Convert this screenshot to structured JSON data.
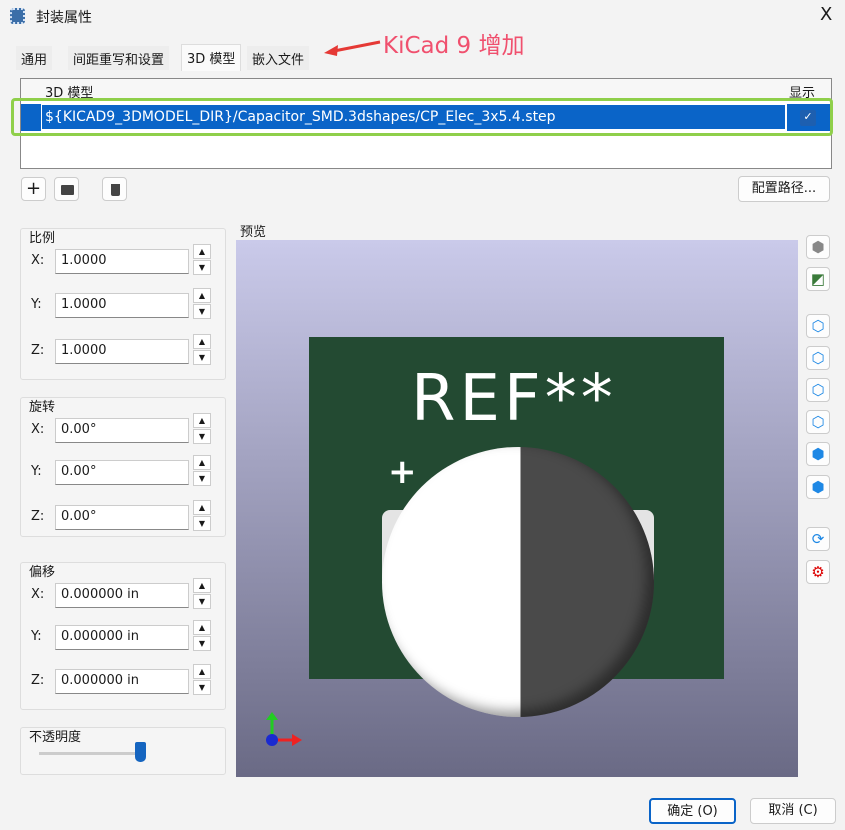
{
  "window": {
    "title": "封装属性",
    "close": "X"
  },
  "annotation": "KiCad 9 增加",
  "tabs": [
    "通用",
    "间距重写和设置",
    "3D 模型",
    "嵌入文件"
  ],
  "models_table": {
    "headers": [
      "3D 模型",
      "显示"
    ],
    "rows": [
      {
        "path": "${KICAD9_3DMODEL_DIR}/Capacitor_SMD.3dshapes/CP_Elec_3x5.4.step",
        "shown": true
      }
    ]
  },
  "toolbar": {
    "add": "+",
    "configure_paths": "配置路径..."
  },
  "scale": {
    "label": "比例",
    "x": "1.0000",
    "y": "1.0000",
    "z": "1.0000"
  },
  "rotation": {
    "label": "旋转",
    "x": "0.00°",
    "y": "0.00°",
    "z": "0.00°"
  },
  "offset": {
    "label": "偏移",
    "x": "0.000000 in",
    "y": "0.000000 in",
    "z": "0.000000 in"
  },
  "axis": {
    "x": "X:",
    "y": "Y:",
    "z": "Z:"
  },
  "opacity": {
    "label": "不透明度",
    "value": 1.0
  },
  "preview": {
    "label": "预览",
    "ref": "REF**",
    "plus": "+"
  },
  "footer": {
    "ok": "确定 (O)",
    "cancel": "取消 (C)"
  },
  "colors": {
    "accent": "#0a64c8",
    "board": "#234a32",
    "highlight": "#8fcf4a",
    "annot": "#f0506e"
  }
}
